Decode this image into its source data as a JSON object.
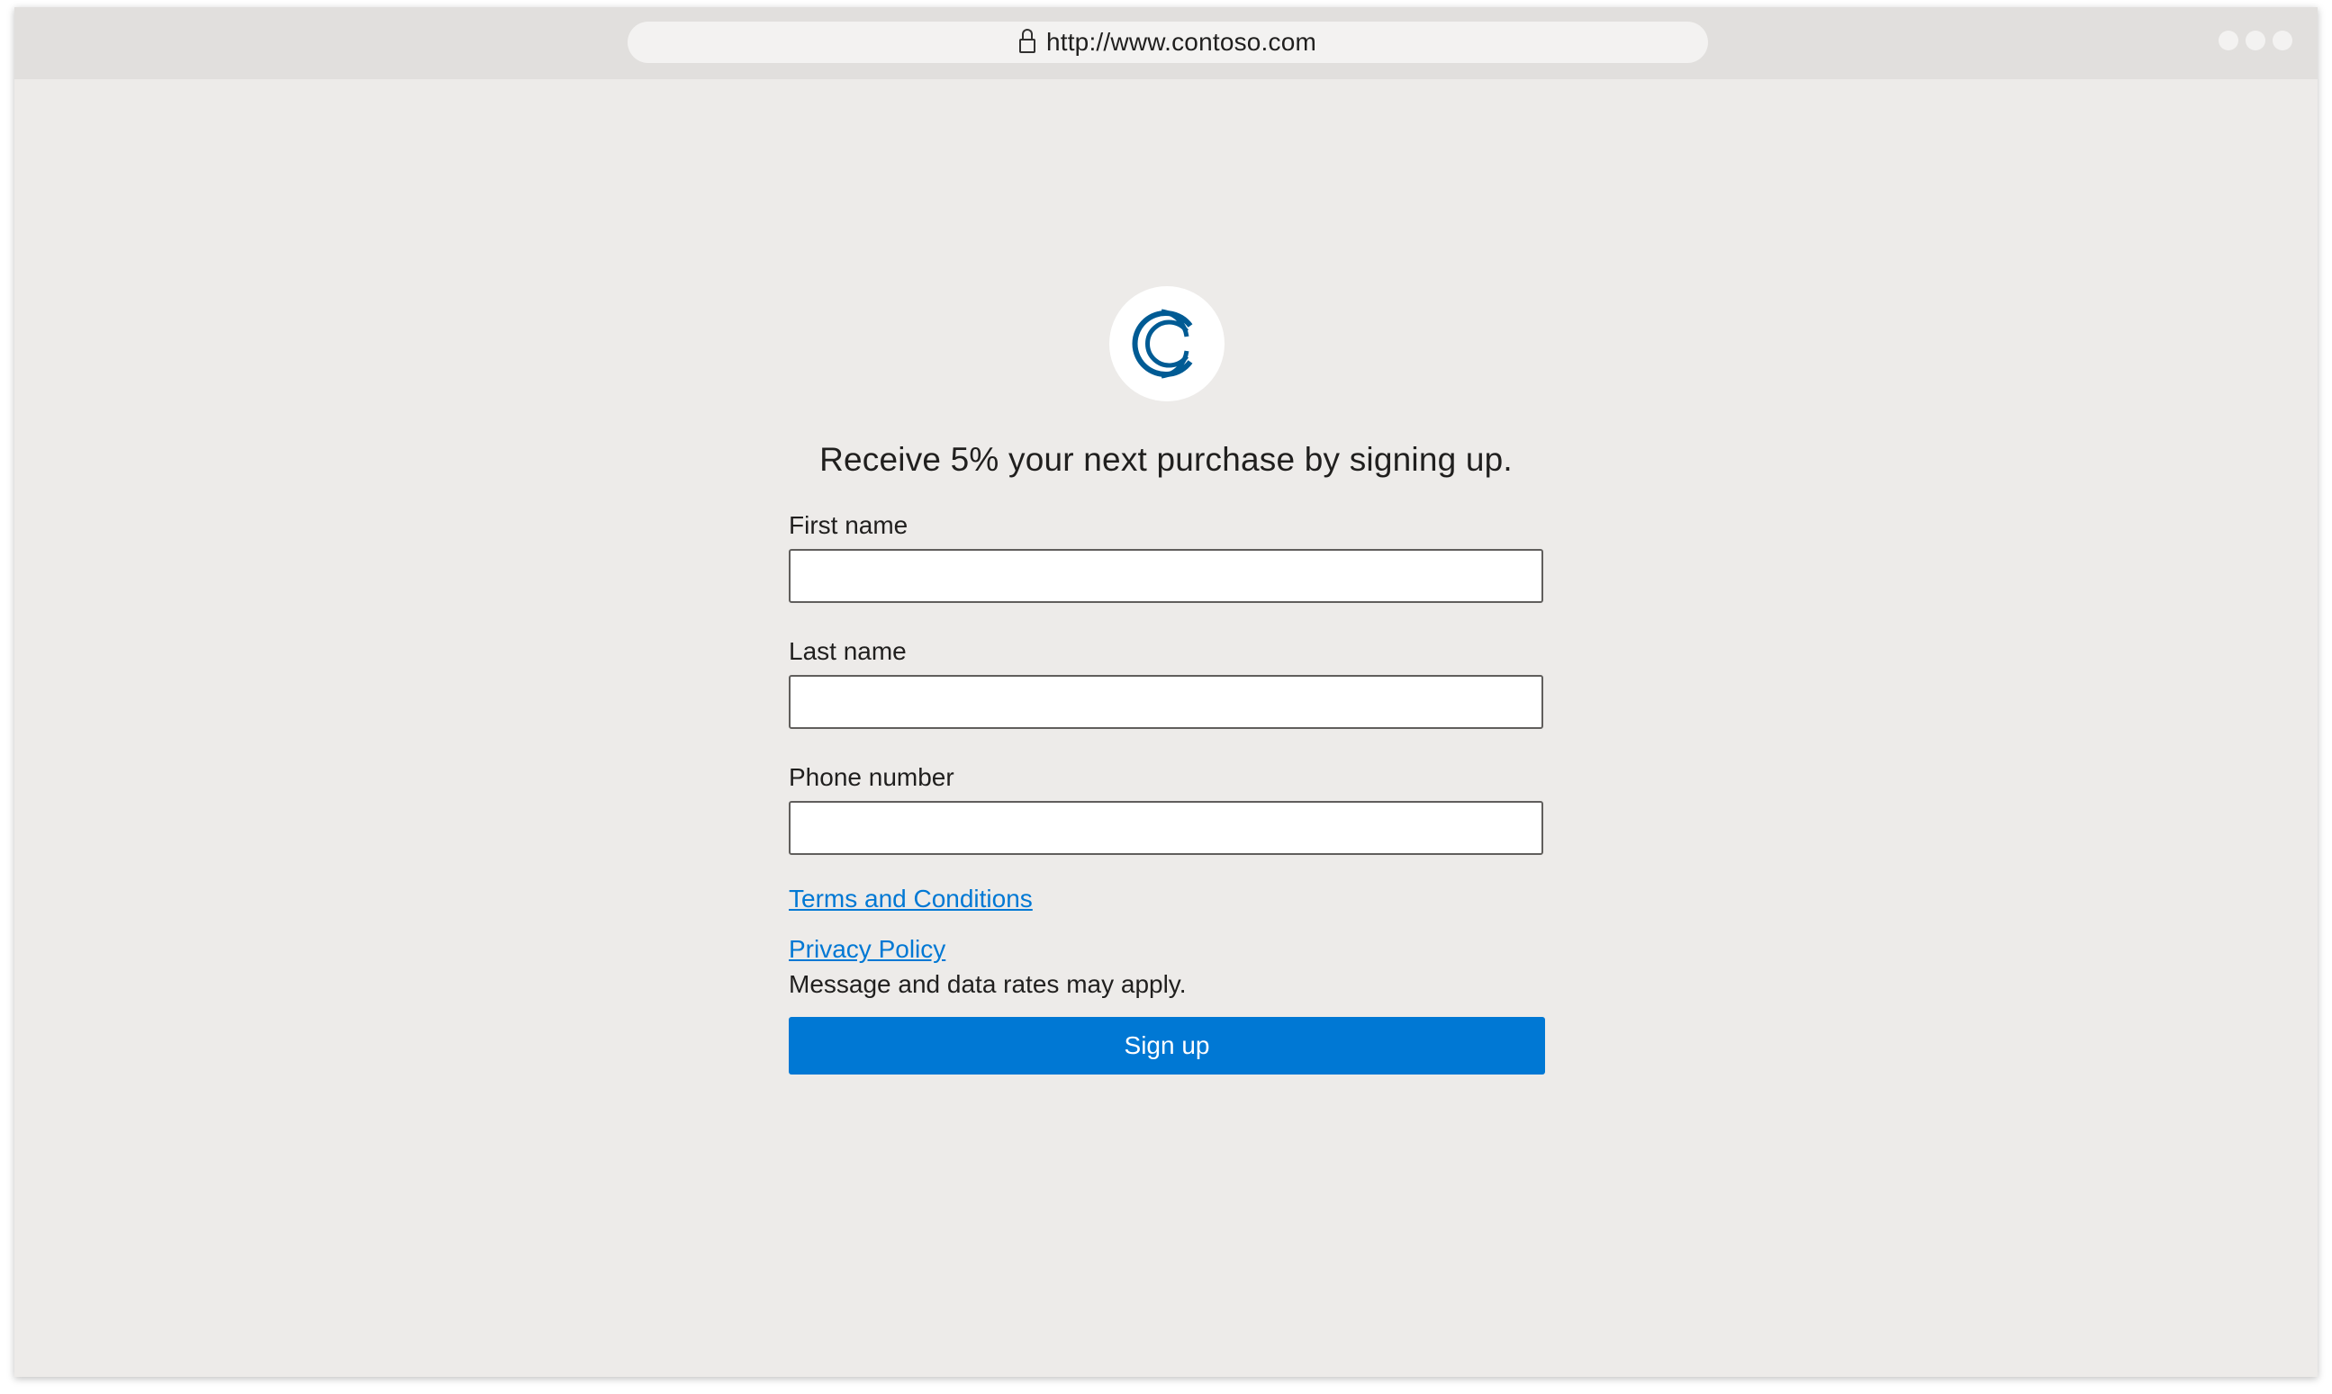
{
  "browser": {
    "url": "http://www.contoso.com",
    "icons": [
      "lock-icon",
      "window-control-dot",
      "window-control-dot",
      "window-control-dot"
    ]
  },
  "logo": {
    "icon": "contoso-c-logo",
    "color": "#005b94"
  },
  "form": {
    "headline": "Receive 5% your next purchase by signing up.",
    "first_name": {
      "label": "First name",
      "value": "",
      "placeholder": ""
    },
    "last_name": {
      "label": "Last name",
      "value": "",
      "placeholder": ""
    },
    "phone": {
      "label": "Phone number",
      "value": "",
      "placeholder": ""
    },
    "terms_link": "Terms and Conditions",
    "privacy_link": "Privacy Policy",
    "rates_notice": "Message and data rates may apply.",
    "submit_label": "Sign up"
  },
  "colors": {
    "accent": "#0078d4",
    "background": "#edebe9",
    "titlebar": "#e1dfdd"
  }
}
